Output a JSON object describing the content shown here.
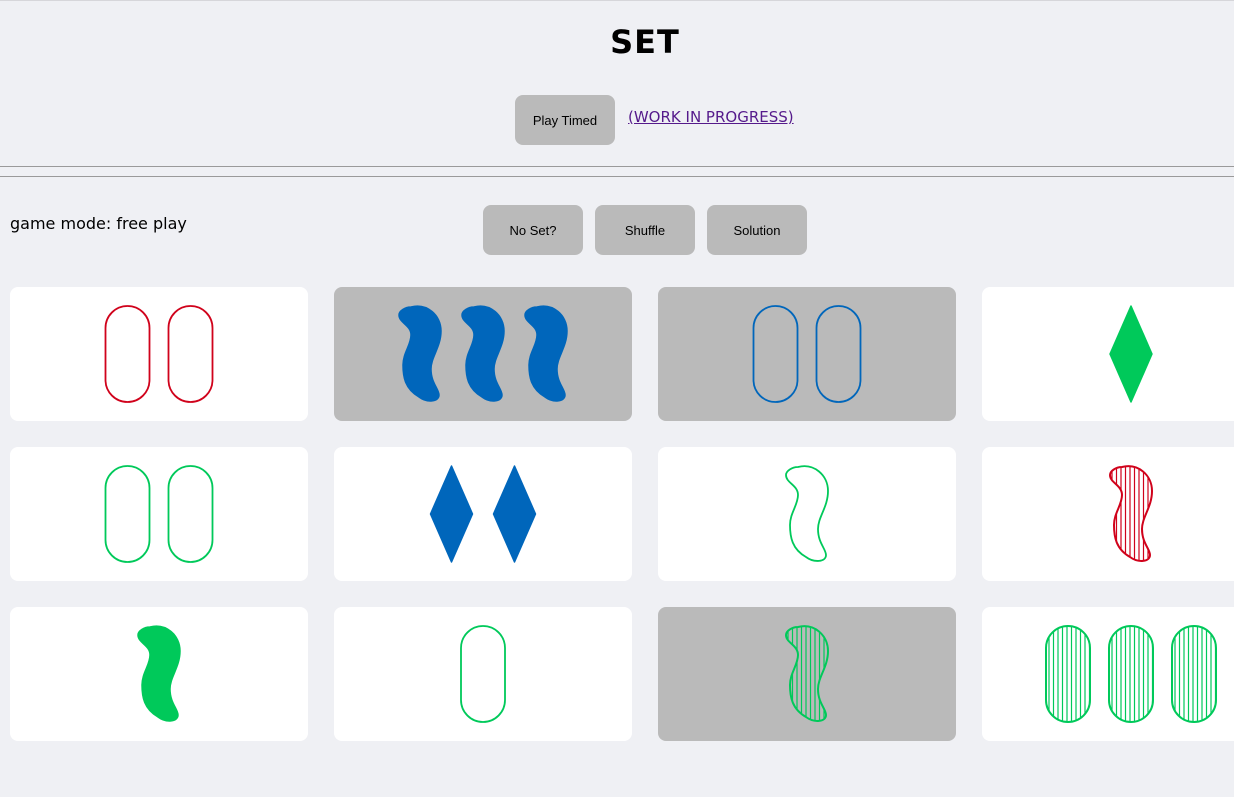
{
  "header": {
    "title": "SET"
  },
  "top_actions": {
    "play_timed": "Play Timed",
    "wip_link": "(WORK IN PROGRESS)"
  },
  "game": {
    "mode_text": "game mode: free play",
    "buttons": {
      "no_set": "No Set?",
      "shuffle": "Shuffle",
      "solution": "Solution"
    }
  },
  "colors": {
    "red": "#d0021b",
    "blue": "#0066bb",
    "green": "#00c95a",
    "selected_bg": "#bababa"
  },
  "cards": [
    {
      "count": 2,
      "shape": "oval",
      "color": "red",
      "fill": "empty",
      "selected": false
    },
    {
      "count": 3,
      "shape": "squiggle",
      "color": "blue",
      "fill": "solid",
      "selected": true
    },
    {
      "count": 2,
      "shape": "oval",
      "color": "blue",
      "fill": "empty",
      "selected": true
    },
    {
      "count": 1,
      "shape": "diamond",
      "color": "green",
      "fill": "solid",
      "selected": false
    },
    {
      "count": 2,
      "shape": "oval",
      "color": "green",
      "fill": "empty",
      "selected": false
    },
    {
      "count": 2,
      "shape": "diamond",
      "color": "blue",
      "fill": "solid",
      "selected": false
    },
    {
      "count": 1,
      "shape": "squiggle",
      "color": "green",
      "fill": "empty",
      "selected": false
    },
    {
      "count": 1,
      "shape": "squiggle",
      "color": "red",
      "fill": "striped",
      "selected": false
    },
    {
      "count": 1,
      "shape": "squiggle",
      "color": "green",
      "fill": "solid",
      "selected": false
    },
    {
      "count": 1,
      "shape": "oval",
      "color": "green",
      "fill": "empty",
      "selected": false
    },
    {
      "count": 1,
      "shape": "squiggle",
      "color": "green",
      "fill": "striped",
      "selected": true
    },
    {
      "count": 3,
      "shape": "oval",
      "color": "green",
      "fill": "striped",
      "selected": false
    }
  ]
}
